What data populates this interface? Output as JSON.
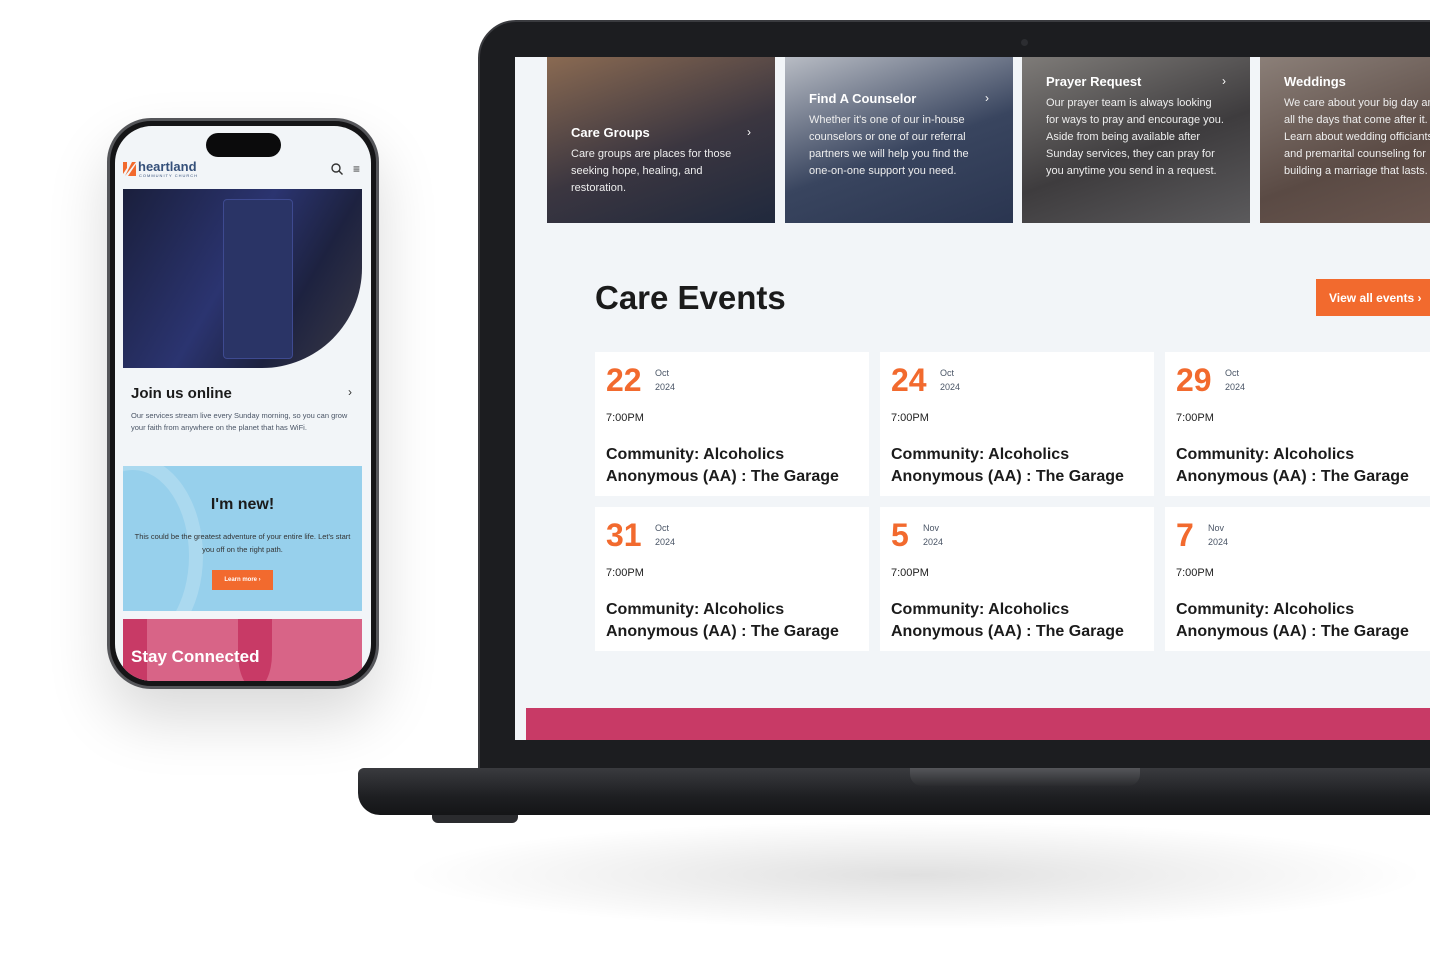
{
  "laptop": {
    "service_cards": [
      {
        "title": "Care Groups",
        "text": "Care groups are places for those seeking hope, healing, and restoration."
      },
      {
        "title": "Find A Counselor",
        "text": "Whether it's one of our in-house counselors or one of our referral partners we will help you find the one-on-one support you need."
      },
      {
        "title": "Prayer Request",
        "text": "Our prayer team is always looking for ways to pray and encourage you. Aside from being available after Sunday services, they can pray for you anytime you send in a request."
      },
      {
        "title": "Weddings",
        "text": "We care about your big day and all the days that come after it. Learn about wedding officiants and premarital counseling for building a marriage that lasts."
      }
    ],
    "section_title": "Care Events",
    "view_all_label": "View all events",
    "events": [
      {
        "day": "22",
        "month": "Oct",
        "year": "2024",
        "time": "7:00PM",
        "title": "Community: Alcoholics Anonymous (AA) : The Garage"
      },
      {
        "day": "24",
        "month": "Oct",
        "year": "2024",
        "time": "7:00PM",
        "title": "Community: Alcoholics Anonymous (AA) : The Garage"
      },
      {
        "day": "29",
        "month": "Oct",
        "year": "2024",
        "time": "7:00PM",
        "title": "Community: Alcoholics Anonymous (AA) : The Garage"
      },
      {
        "day": "31",
        "month": "Oct",
        "year": "2024",
        "time": "7:00PM",
        "title": "Community: Alcoholics Anonymous (AA) : The Garage"
      },
      {
        "day": "5",
        "month": "Nov",
        "year": "2024",
        "time": "7:00PM",
        "title": "Community: Alcoholics Anonymous (AA) : The Garage"
      },
      {
        "day": "7",
        "month": "Nov",
        "year": "2024",
        "time": "7:00PM",
        "title": "Community: Alcoholics Anonymous (AA) : The Garage"
      }
    ]
  },
  "phone": {
    "logo": {
      "name": "heartland",
      "sub": "COMMUNITY CHURCH"
    },
    "join": {
      "title": "Join us online",
      "text": "Our services stream live every Sunday morning, so you can grow your faith from anywhere on the planet that has WiFi."
    },
    "new": {
      "title": "I'm new!",
      "text": "This could be the greatest adventure of your entire life. Let's start you off on the right path.",
      "button": "Learn more"
    },
    "stay": {
      "title": "Stay Connected"
    }
  },
  "colors": {
    "accent": "#f26a2e",
    "pink": "#c83a66",
    "light_blue": "#97d0ec",
    "background": "#f2f5f8"
  }
}
